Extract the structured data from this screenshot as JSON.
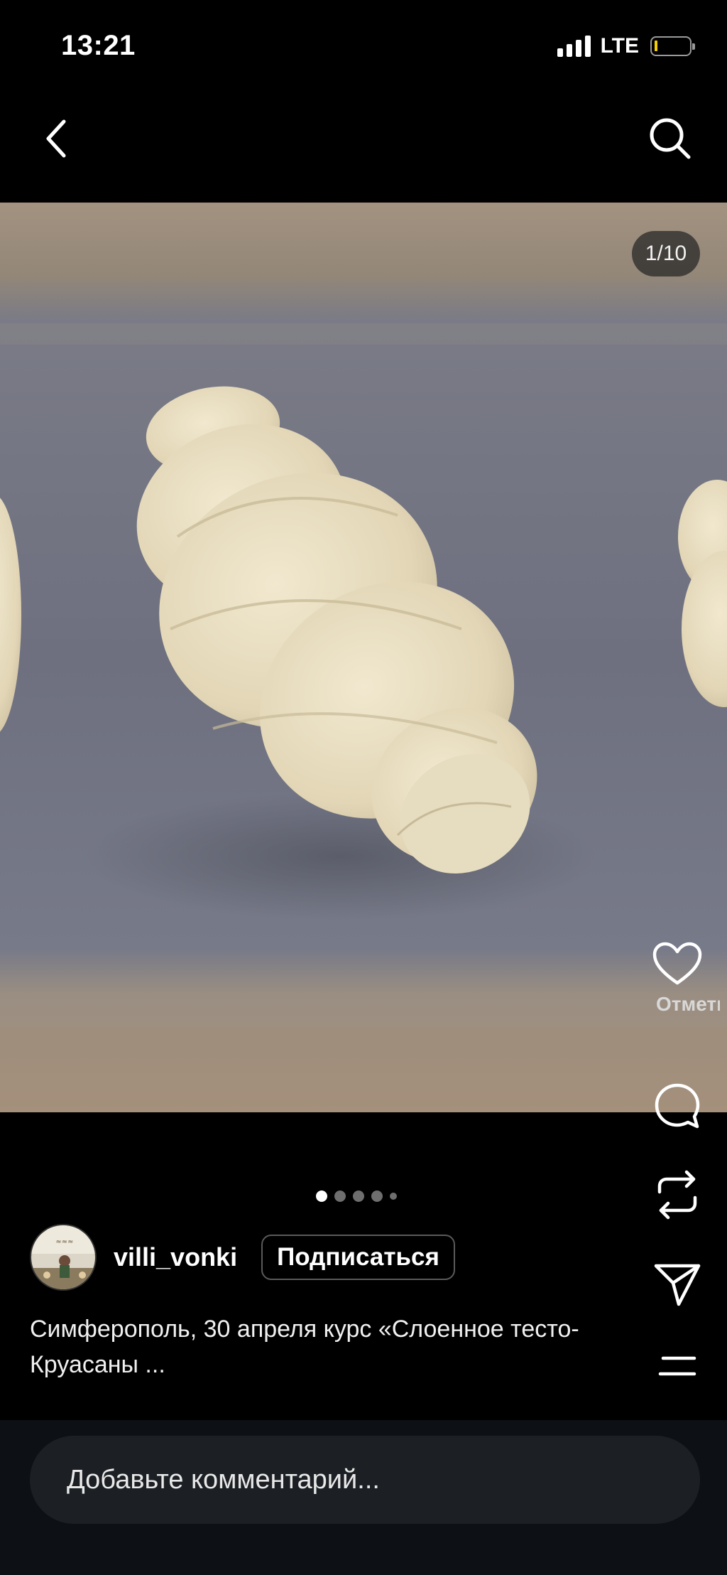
{
  "status_bar": {
    "time": "13:21",
    "network": "LTE",
    "battery_level": 0.05
  },
  "nav": {
    "back_icon": "chevron-left-icon",
    "search_icon": "search-icon"
  },
  "post": {
    "image_counter": "1/10",
    "carousel": {
      "total_dots": 5,
      "active_index": 0
    },
    "actions": {
      "like_label": "Отметк",
      "like_icon": "heart-icon",
      "comment_icon": "comment-icon",
      "repost_icon": "repost-icon",
      "share_icon": "send-icon",
      "more_icon": "menu-icon"
    },
    "author": {
      "username": "villi_vonki",
      "follow_label": "Подписаться"
    },
    "caption": "Симферополь, 30 апреля курс «Слоенное тесто-Круасаны ..."
  },
  "comment": {
    "placeholder": "Добавьте комментарий..."
  },
  "colors": {
    "background": "#000000",
    "comment_bar": "#0d1014",
    "battery_accent": "#f5d000"
  }
}
